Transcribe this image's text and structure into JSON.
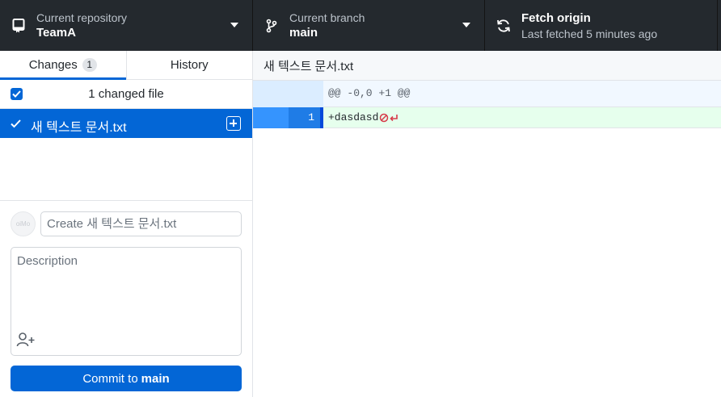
{
  "toolbar": {
    "repository": {
      "label": "Current repository",
      "value": "TeamA",
      "icon": "repo-icon"
    },
    "branch": {
      "label": "Current branch",
      "value": "main",
      "icon": "branch-icon"
    },
    "fetch": {
      "title": "Fetch origin",
      "subtitle": "Last fetched 5 minutes ago",
      "icon": "sync-icon"
    }
  },
  "sidebar": {
    "tabs": [
      {
        "label": "Changes",
        "badge": "1",
        "active": true
      },
      {
        "label": "History",
        "active": false
      }
    ],
    "changed_files_label": "1 changed file",
    "files": [
      {
        "name": "새 텍스트 문서.txt",
        "status": "added",
        "checked": true,
        "selected": true
      }
    ],
    "commit": {
      "avatar_text": "oiMo",
      "summary_placeholder": "Create 새 텍스트 문서.txt",
      "description_placeholder": "Description",
      "button_prefix": "Commit to",
      "button_branch": "main"
    }
  },
  "diff": {
    "file_title": "새 텍스트 문서.txt",
    "hunk_header": "@@ -0,0 +1 @@",
    "lines": [
      {
        "new_line_no": "1",
        "text": "+dasdasd",
        "type": "added"
      }
    ]
  },
  "colors": {
    "toolbar_bg": "#24292e",
    "accent": "#0366d6",
    "added_bg": "#e6ffed",
    "hunk_bg": "#f1f8ff"
  }
}
